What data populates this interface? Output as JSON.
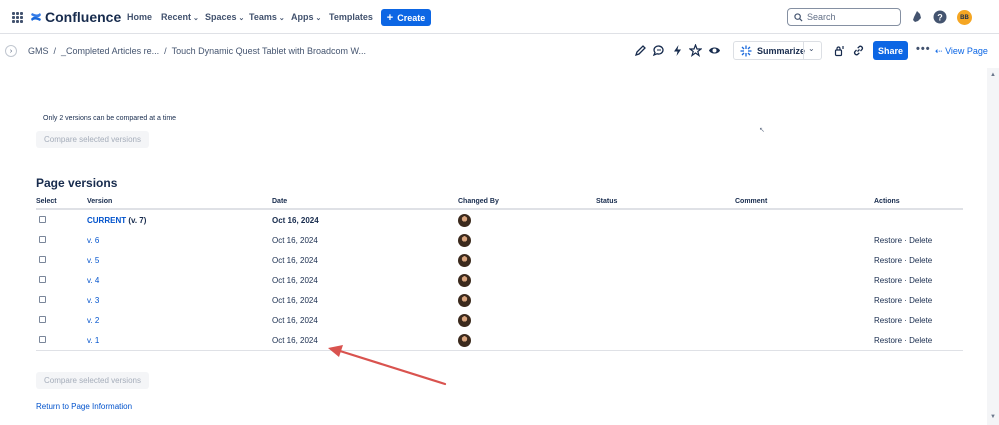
{
  "topnav": {
    "app_name": "Confluence",
    "items": [
      {
        "label": "Home",
        "has_chevron": false
      },
      {
        "label": "Recent",
        "has_chevron": true
      },
      {
        "label": "Spaces",
        "has_chevron": true
      },
      {
        "label": "Teams",
        "has_chevron": true
      },
      {
        "label": "Apps",
        "has_chevron": true
      },
      {
        "label": "Templates",
        "has_chevron": false
      }
    ],
    "create_label": "Create",
    "search_placeholder": "Search",
    "user_initials": "BB",
    "icons": [
      "apps-grid-icon",
      "confluence-logo-icon",
      "notifications-icon",
      "help-icon"
    ]
  },
  "breadcrumb": {
    "items": [
      "GMS",
      "_Completed Articles re...",
      "Touch Dynamic Quest Tablet with Broadcom W..."
    ]
  },
  "toolbar": {
    "summarize_label": "Summarize",
    "share_label": "Share",
    "more_label": "•••",
    "view_page_label": "View Page",
    "icons": [
      "edit-icon",
      "comment-icon",
      "automation-icon",
      "star-icon",
      "watch-icon",
      "restrictions-icon",
      "link-icon"
    ]
  },
  "compare": {
    "note": "Only 2 versions can be compared at a time",
    "button_label": "Compare selected versions"
  },
  "versions": {
    "title": "Page versions",
    "columns": [
      "Select",
      "Version",
      "Date",
      "Changed By",
      "Status",
      "Comment",
      "Actions"
    ],
    "rows": [
      {
        "version": "CURRENT",
        "version_suffix": "(v. 7)",
        "date": "Oct 16, 2024",
        "actions": ""
      },
      {
        "version": "v. 6",
        "date": "Oct 16, 2024",
        "actions": "Restore · Delete"
      },
      {
        "version": "v. 5",
        "date": "Oct 16, 2024",
        "actions": "Restore · Delete"
      },
      {
        "version": "v. 4",
        "date": "Oct 16, 2024",
        "actions": "Restore · Delete"
      },
      {
        "version": "v. 3",
        "date": "Oct 16, 2024",
        "actions": "Restore · Delete"
      },
      {
        "version": "v. 2",
        "date": "Oct 16, 2024",
        "actions": "Restore · Delete"
      },
      {
        "version": "v. 1",
        "date": "Oct 16, 2024",
        "actions": "Restore · Delete"
      }
    ]
  },
  "return_link": "Return to Page Information",
  "colors": {
    "primary": "#0c66e4",
    "link": "#0052cc",
    "text": "#172b4d",
    "annotation_arrow": "#d9534f"
  }
}
